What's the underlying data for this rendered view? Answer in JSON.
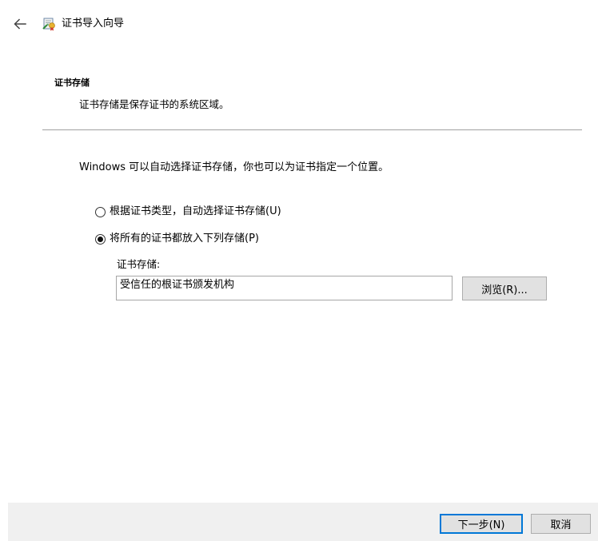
{
  "window": {
    "title": "证书导入向导",
    "back_icon": "arrow-left-icon",
    "app_icon": "certificate-icon"
  },
  "header": {
    "title": "证书存储",
    "description": "证书存储是保存证书的系统区域。"
  },
  "body": {
    "intro": "Windows 可以自动选择证书存储，你也可以为证书指定一个位置。",
    "options": [
      {
        "label": "根据证书类型，自动选择证书存储(U)",
        "selected": false
      },
      {
        "label": "将所有的证书都放入下列存储(P)",
        "selected": true
      }
    ],
    "store_label": "证书存储:",
    "store_value": "受信任的根证书颁发机构",
    "browse_label": "浏览(R)..."
  },
  "footer": {
    "next_label": "下一步(N)",
    "cancel_label": "取消"
  },
  "colors": {
    "accent": "#0078d7",
    "footer_bg": "#f0f0f0",
    "button_bg": "#e1e1e1"
  }
}
